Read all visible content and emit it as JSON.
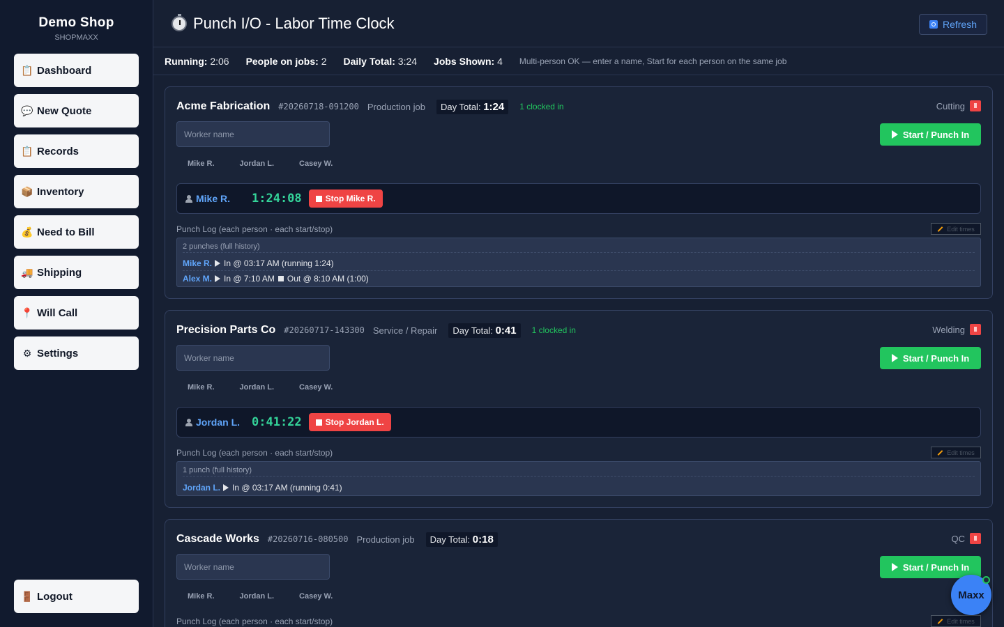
{
  "brand": {
    "name": "Demo Shop",
    "sub": "SHOPMAXX"
  },
  "nav": [
    {
      "label": "Dashboard",
      "icon": "clipboard-icon"
    },
    {
      "label": "New Quote",
      "icon": "speech-bubble-icon"
    },
    {
      "label": "Records",
      "icon": "clipboard-icon"
    },
    {
      "label": "Inventory",
      "icon": "box-icon"
    },
    {
      "label": "Need to Bill",
      "icon": "money-bag-icon"
    },
    {
      "label": "Shipping",
      "icon": "truck-icon"
    },
    {
      "label": "Will Call",
      "icon": "pin-icon"
    },
    {
      "label": "Settings",
      "icon": "gear-icon"
    }
  ],
  "logout": {
    "label": "Logout",
    "icon": "door-icon"
  },
  "header": {
    "title": "Punch I/O - Labor Time Clock",
    "refresh_label": "Refresh"
  },
  "stats": {
    "running_label": "Running:",
    "running_value": "2:06",
    "people_label": "People on jobs:",
    "people_value": "2",
    "daily_label": "Daily Total:",
    "daily_value": "3:24",
    "jobs_label": "Jobs Shown:",
    "jobs_value": "4",
    "note": "Multi-person OK — enter a name, Start for each person on the same job"
  },
  "common": {
    "worker_placeholder": "Worker name",
    "start_label": "Start / Punch In",
    "log_label": "Punch Log (each person · each start/stop)",
    "edit_times": "Edit times",
    "day_total_label": "Day Total:",
    "chips": [
      "Mike R.",
      "Jordan L.",
      "Casey W."
    ]
  },
  "jobs": [
    {
      "customer": "Acme Fabrication",
      "job_no": "#20260718-091200",
      "type": "Production job",
      "day_total": "1:24",
      "clocked": "1 clocked in",
      "stage": "Cutting",
      "active": {
        "name": "Mike R.",
        "timer": "1:24:08",
        "stop_label": "Stop Mike R."
      },
      "log_count": "2 punches (full history)",
      "log": [
        {
          "name": "Mike R.",
          "in": "In @ 03:17 AM (running 1:24)",
          "out": ""
        },
        {
          "name": "Alex M.",
          "in": "In @ 7:10 AM",
          "out": "Out @ 8:10 AM (1:00)"
        }
      ]
    },
    {
      "customer": "Precision Parts Co",
      "job_no": "#20260717-143300",
      "type": "Service / Repair",
      "day_total": "0:41",
      "clocked": "1 clocked in",
      "stage": "Welding",
      "active": {
        "name": "Jordan L.",
        "timer": "0:41:22",
        "stop_label": "Stop Jordan L."
      },
      "log_count": "1 punch (full history)",
      "log": [
        {
          "name": "Jordan L.",
          "in": "In @ 03:17 AM (running 0:41)",
          "out": ""
        }
      ]
    },
    {
      "customer": "Cascade Works",
      "job_no": "#20260716-080500",
      "type": "Production job",
      "day_total": "0:18",
      "stage": "QC"
    }
  ],
  "maxx": {
    "label": "Maxx"
  }
}
